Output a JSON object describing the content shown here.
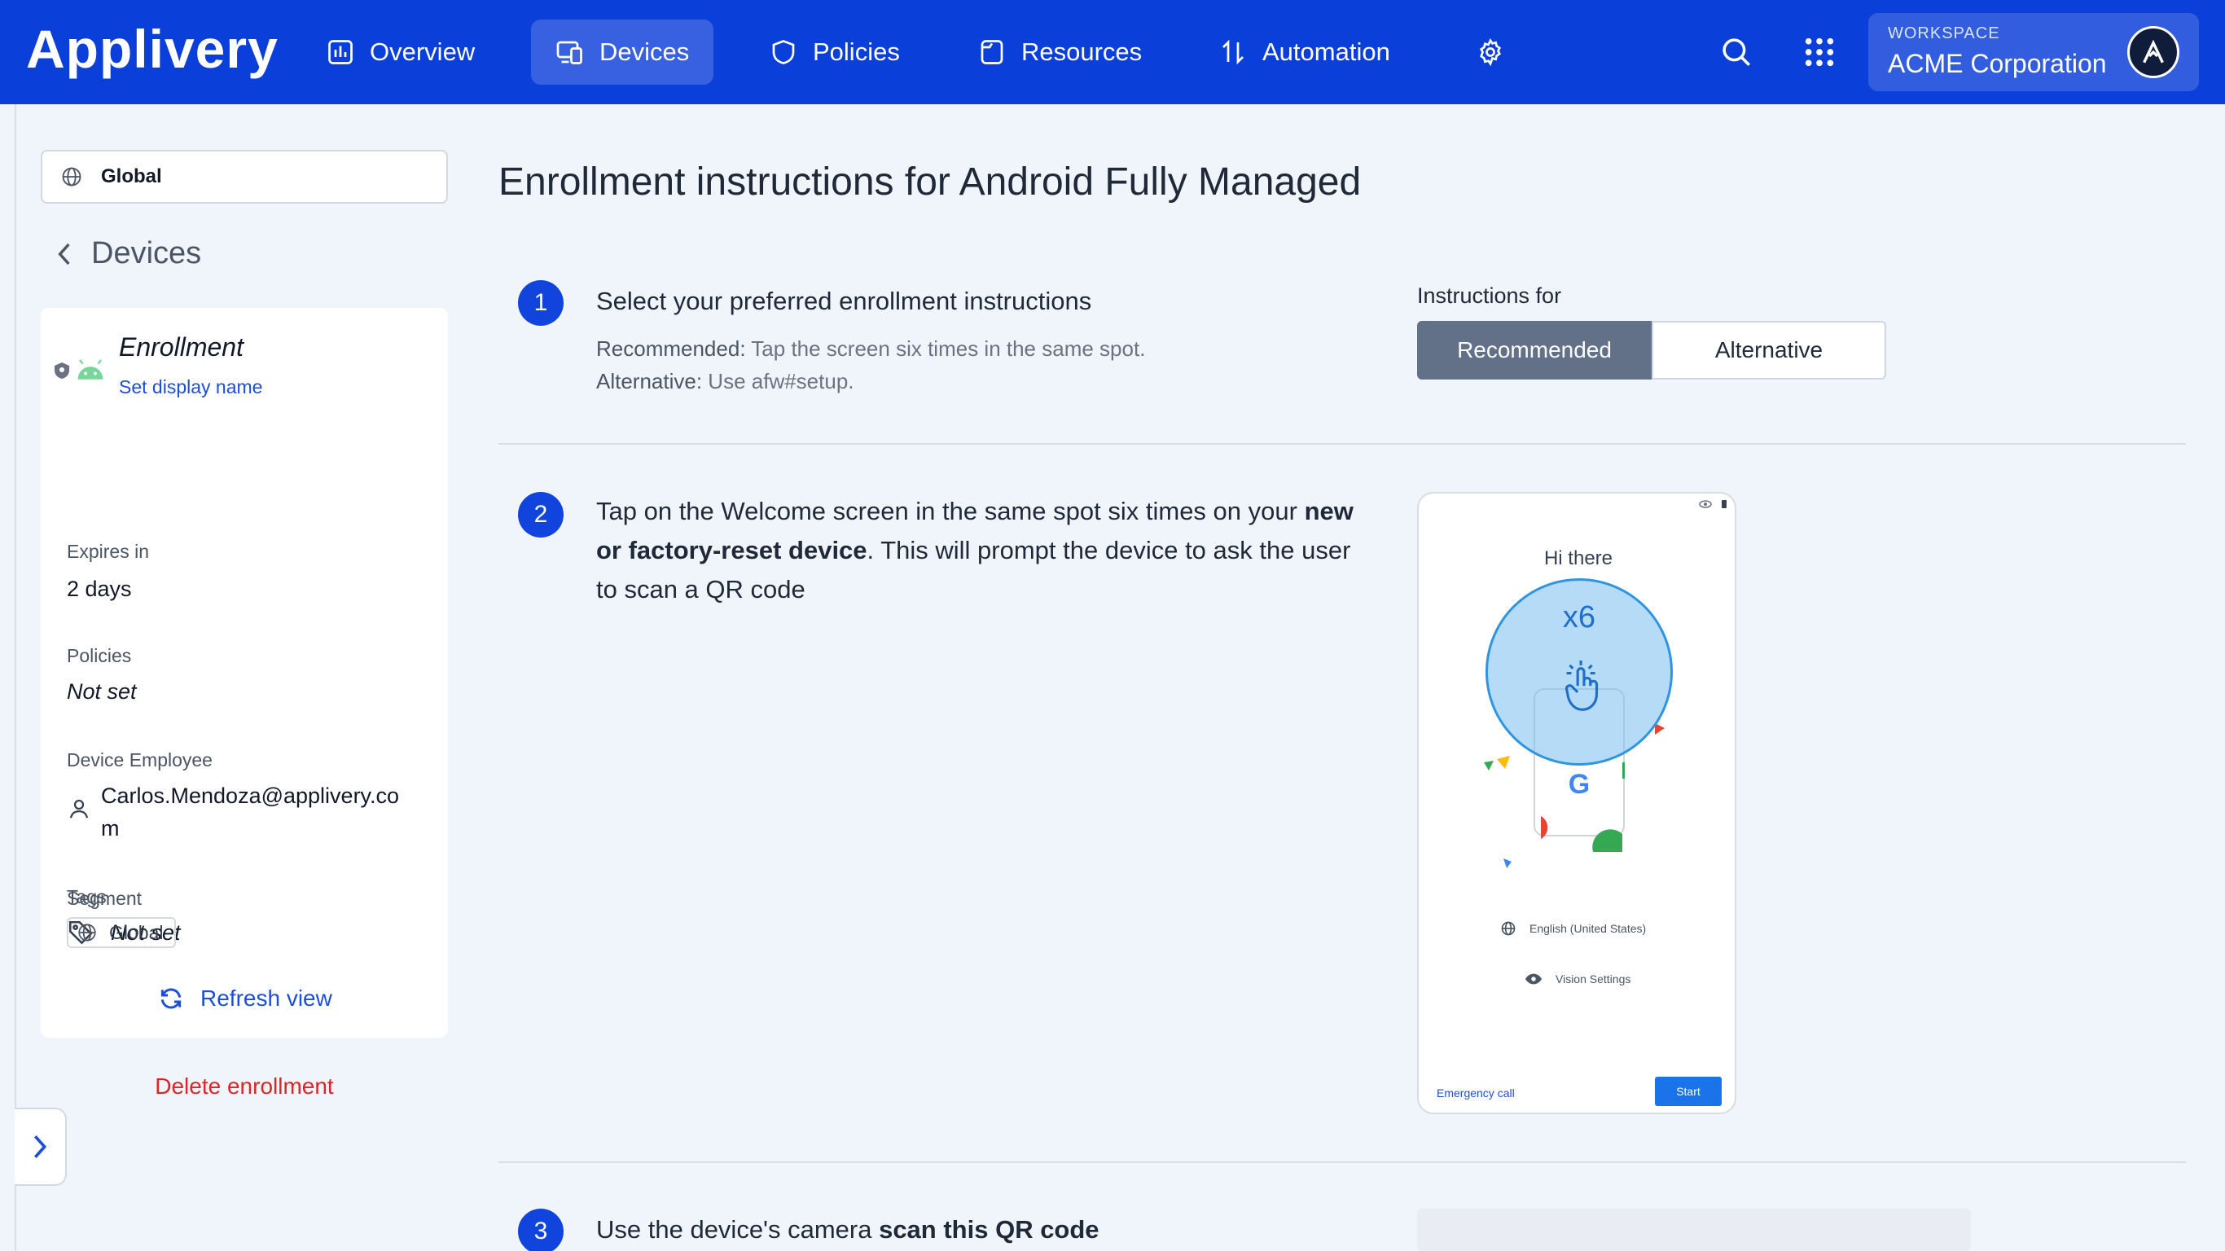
{
  "brand": "Applivery",
  "nav": {
    "overview": "Overview",
    "devices": "Devices",
    "policies": "Policies",
    "resources": "Resources",
    "automation": "Automation"
  },
  "workspace": {
    "caption": "WORKSPACE",
    "name": "ACME Corporation"
  },
  "sidebar": {
    "scope": "Global",
    "back_label": "Devices",
    "card": {
      "title": "Enrollment",
      "set_display_name": "Set display name",
      "expires_label": "Expires in",
      "expires_value": "2 days",
      "policies_label": "Policies",
      "policies_value": "Not set",
      "employee_label": "Device Employee",
      "employee_value_line1": "Carlos.Mendoza@applivery.co",
      "employee_value_line2": "m",
      "tags_label": "Tags",
      "tags_value": "Not set",
      "segment_label": "Segment",
      "segment_value": "Global",
      "refresh": "Refresh view"
    },
    "delete": "Delete enrollment"
  },
  "main": {
    "title": "Enrollment instructions for Android Fully Managed",
    "step1": {
      "num": "1",
      "text": "Select your preferred enrollment instructions",
      "rec_label": "Recommended:",
      "rec_text": " Tap the screen six times in the same spot.",
      "alt_label": "Alternative:",
      "alt_text": " Use afw#setup."
    },
    "instructions_for": "Instructions for",
    "toggle": {
      "recommended": "Recommended",
      "alternative": "Alternative",
      "selected": "Recommended"
    },
    "step2": {
      "num": "2",
      "text_a": "Tap on the Welcome screen in the same spot six times on your ",
      "text_b": "new",
      "text_c": "or factory-reset device",
      "text_d": ". This will prompt the device to ask the user",
      "text_e": "to scan a QR code"
    },
    "phone": {
      "greeting": "Hi there",
      "tap_count": "x6",
      "language": "English (United States)",
      "vision": "Vision Settings",
      "emergency": "Emergency call",
      "start": "Start"
    },
    "step3": {
      "num": "3",
      "text_a": "Use the device's camera ",
      "text_b": "scan this QR code"
    }
  },
  "colors": {
    "primary": "#0b3fd9",
    "accent": "#1144dd",
    "danger": "#dc2626",
    "toggle_selected": "#627088"
  }
}
